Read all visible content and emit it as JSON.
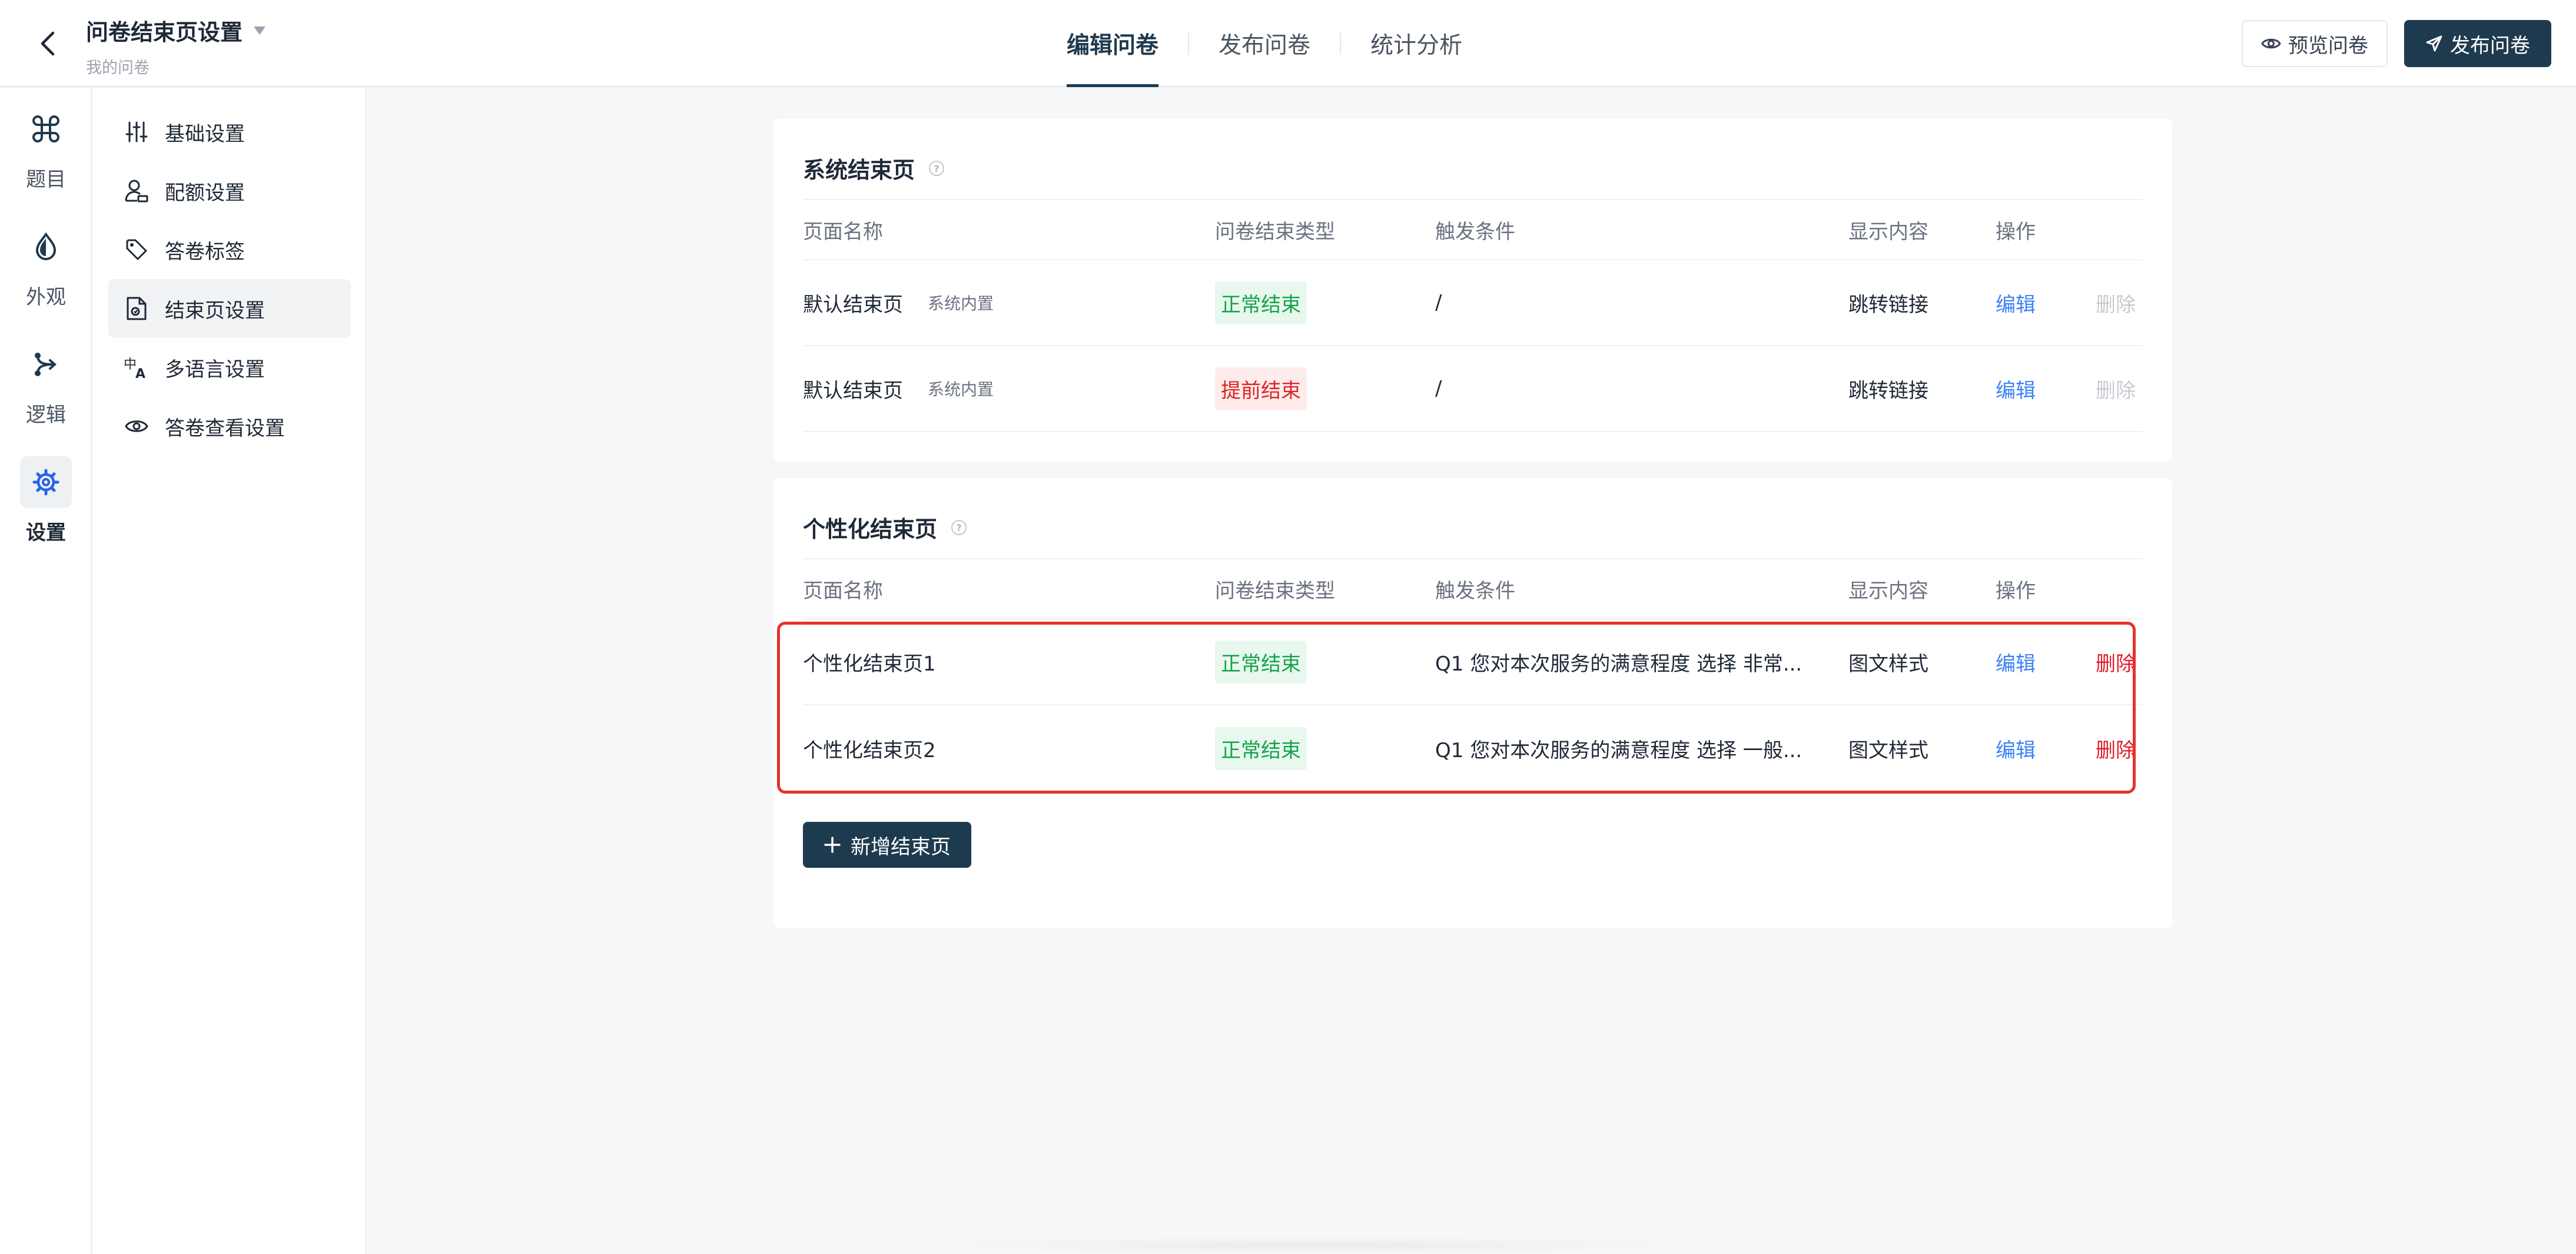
{
  "header": {
    "title": "问卷结束页设置",
    "subtitle": "我的问卷",
    "tabs": [
      {
        "label": "编辑问卷",
        "active": true
      },
      {
        "label": "发布问卷",
        "active": false
      },
      {
        "label": "统计分析",
        "active": false
      }
    ],
    "preview_label": "预览问卷",
    "publish_label": "发布问卷"
  },
  "rail": {
    "items": [
      {
        "label": "题目",
        "icon": "command-icon"
      },
      {
        "label": "外观",
        "icon": "droplet-icon"
      },
      {
        "label": "逻辑",
        "icon": "branch-icon"
      },
      {
        "label": "设置",
        "icon": "gear-icon",
        "active": true
      }
    ]
  },
  "menu": {
    "items": [
      {
        "label": "基础设置",
        "icon": "sliders-icon"
      },
      {
        "label": "配额设置",
        "icon": "user-quota-icon"
      },
      {
        "label": "答卷标签",
        "icon": "tag-icon"
      },
      {
        "label": "结束页设置",
        "icon": "file-end-icon",
        "active": true
      },
      {
        "label": "多语言设置",
        "icon": "language-icon"
      },
      {
        "label": "答卷查看设置",
        "icon": "eye-icon"
      }
    ]
  },
  "system_section": {
    "title": "系统结束页",
    "columns": [
      "页面名称",
      "问卷结束类型",
      "触发条件",
      "显示内容",
      "操作"
    ],
    "rows": [
      {
        "name": "默认结束页",
        "tag": "系统内置",
        "type": "正常结束",
        "type_kind": "ok",
        "trigger": "/",
        "content": "跳转链接",
        "edit": "编辑",
        "delete": "删除"
      },
      {
        "name": "默认结束页",
        "tag": "系统内置",
        "type": "提前结束",
        "type_kind": "early",
        "trigger": "/",
        "content": "跳转链接",
        "edit": "编辑",
        "delete": "删除"
      }
    ]
  },
  "custom_section": {
    "title": "个性化结束页",
    "columns": [
      "页面名称",
      "问卷结束类型",
      "触发条件",
      "显示内容",
      "操作"
    ],
    "rows": [
      {
        "name": "个性化结束页1",
        "type": "正常结束",
        "trigger": "Q1 您对本次服务的满意程度 选择 非常...",
        "content": "图文样式",
        "edit": "编辑",
        "delete": "删除"
      },
      {
        "name": "个性化结束页2",
        "type": "正常结束",
        "trigger": "Q1 您对本次服务的满意程度 选择 一般...",
        "content": "图文样式",
        "edit": "编辑",
        "delete": "删除"
      }
    ],
    "add_label": "新增结束页"
  },
  "colors": {
    "primary": "#1e3a4f",
    "link": "#3b82f6",
    "danger": "#e11d2a",
    "success": "#16a34a",
    "highlight": "#e5322d"
  }
}
